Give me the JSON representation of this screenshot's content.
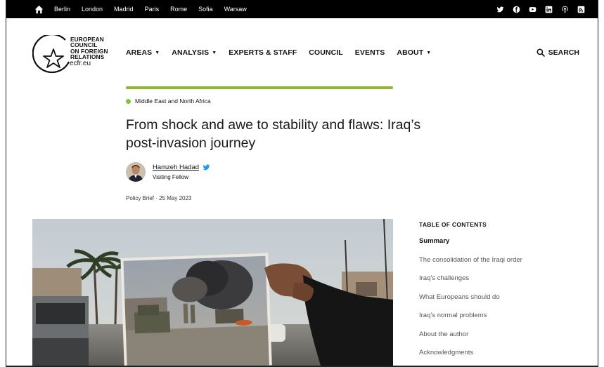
{
  "topbar": {
    "cities": [
      "Berlin",
      "London",
      "Madrid",
      "Paris",
      "Rome",
      "Sofia",
      "Warsaw"
    ],
    "socials": [
      "twitter-icon",
      "facebook-icon",
      "youtube-icon",
      "linkedin-icon",
      "podcast-icon",
      "rss-icon"
    ]
  },
  "logo": {
    "line1": "EUROPEAN",
    "line2": "COUNCIL",
    "line3": "ON FOREIGN",
    "line4": "RELATIONS",
    "url": "ecfr.eu"
  },
  "nav": {
    "areas": "AREAS",
    "analysis": "ANALYSIS",
    "experts": "EXPERTS & STAFF",
    "council": "COUNCIL",
    "events": "EVENTS",
    "about": "ABOUT",
    "search": "SEARCH"
  },
  "article": {
    "region": "Middle East and North Africa",
    "title": "From shock and awe to stability and flaws: Iraq’s post-invasion journey",
    "author_name": "Hamzeh Hadad",
    "author_role": "Visiting Fellow",
    "meta": "Policy Brief · 25 May 2023"
  },
  "toc": {
    "title": "TABLE OF CONTENTS",
    "items": [
      "Summary",
      "The consolidation of the Iraqi order",
      "Iraq’s challenges",
      "What Europeans should do",
      "Iraq’s normal problems",
      "About the author",
      "Acknowledgments"
    ]
  },
  "colors": {
    "accent_green": "#8fb82a",
    "region_dot": "#7fc242",
    "twitter_blue": "#1d9bf0"
  }
}
